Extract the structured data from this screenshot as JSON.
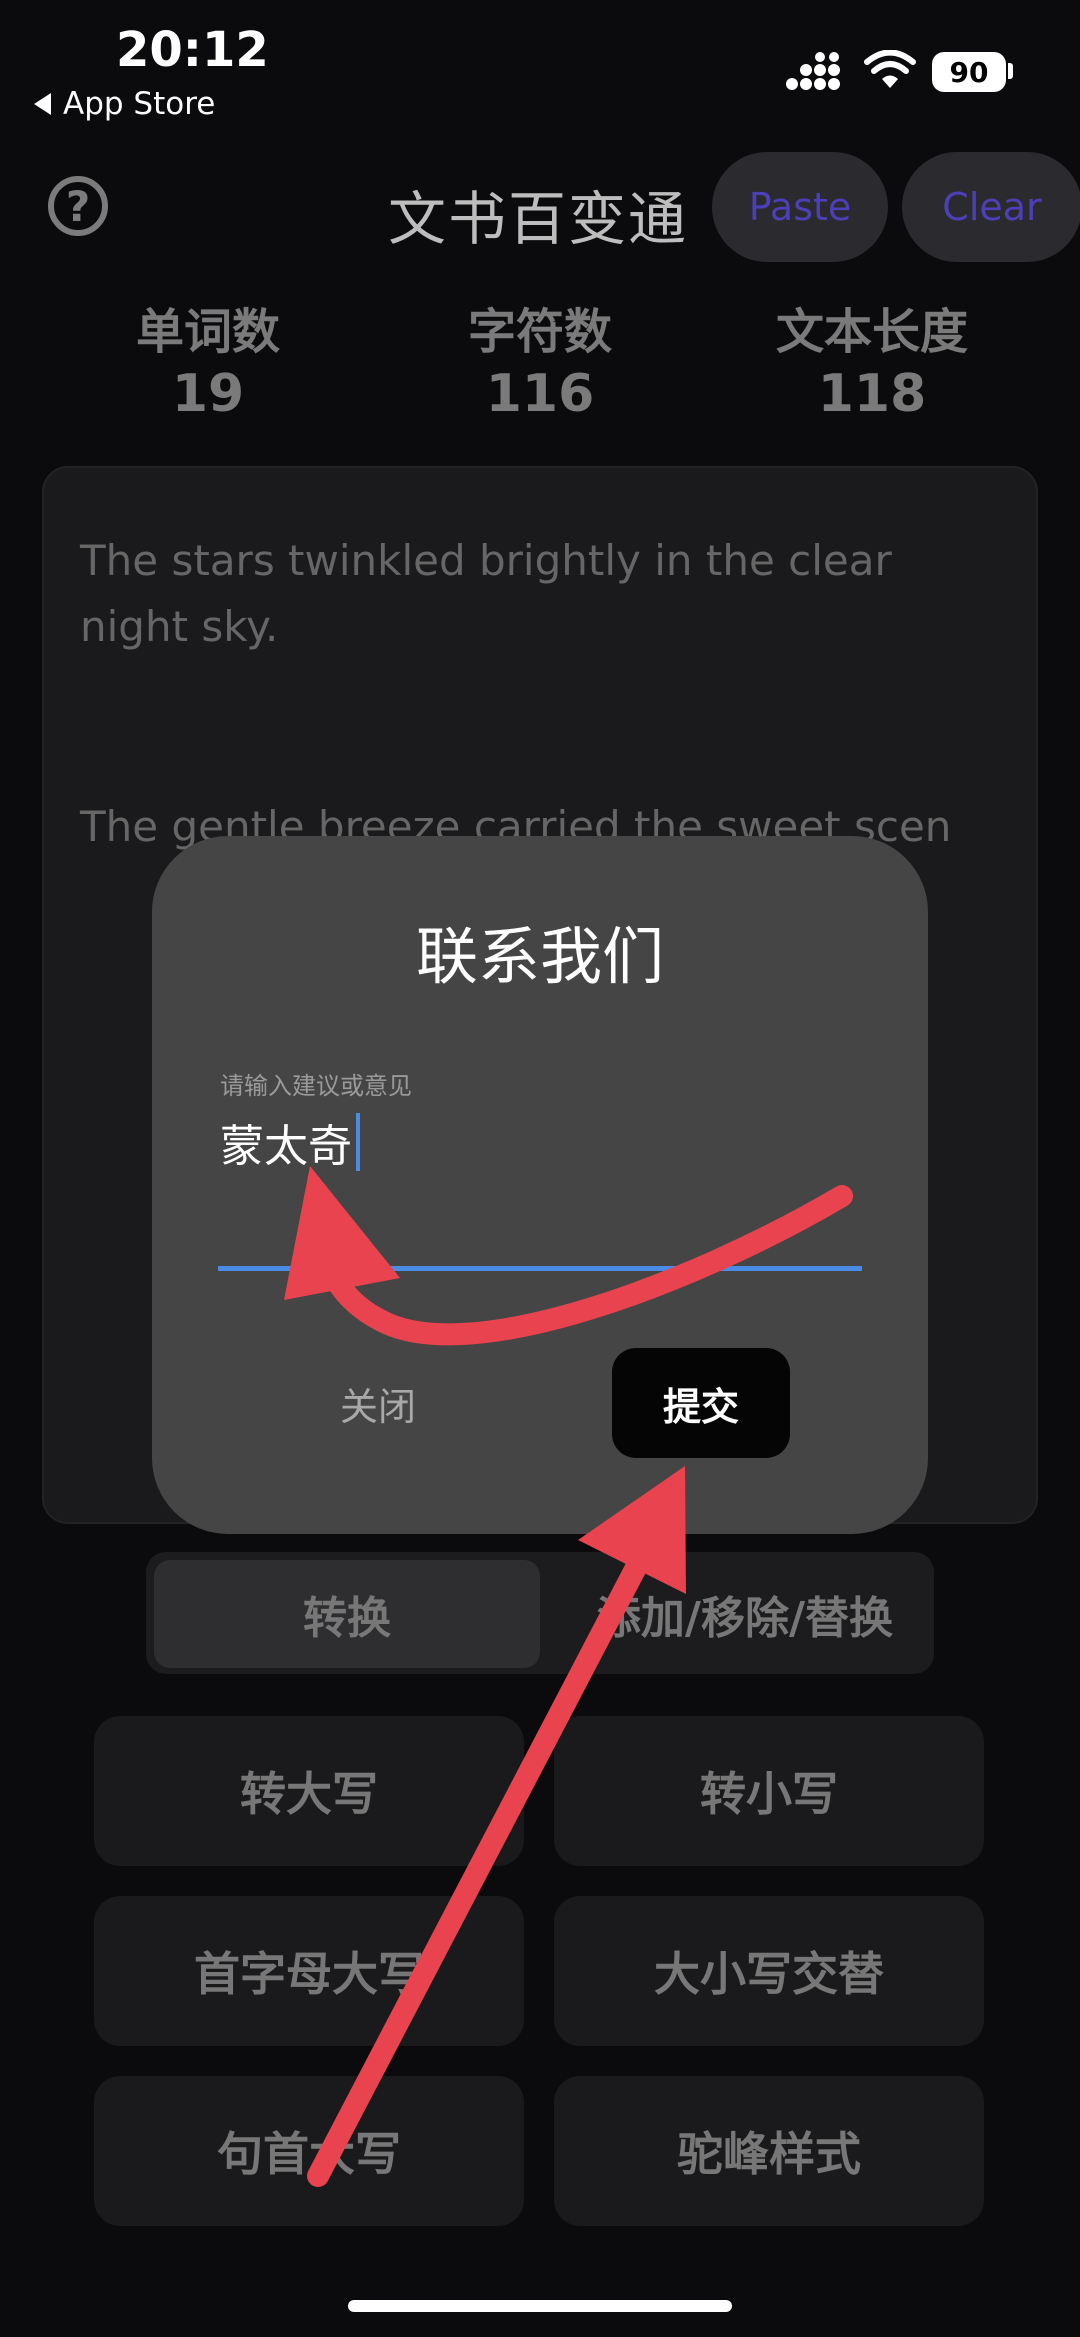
{
  "status_bar": {
    "time": "20:12",
    "back_label": "App Store",
    "battery": "90"
  },
  "header": {
    "title": "文书百变通",
    "paste_label": "Paste",
    "clear_label": "Clear",
    "help_icon": "question-circle-icon"
  },
  "stats": [
    {
      "label": "单词数",
      "value": "19"
    },
    {
      "label": "字符数",
      "value": "116"
    },
    {
      "label": "文本长度",
      "value": "118"
    }
  ],
  "editor": {
    "paragraph1": "The stars  twinkled brightly in  the clear night sky.",
    "paragraph2": "The gentle breeze carried the sweet scen"
  },
  "segmented": {
    "active": "转换",
    "other": "添加/移除/替换"
  },
  "actions": [
    "转大写",
    "转小写",
    "首字母大写",
    "大小写交替",
    "句首大写",
    "驼峰样式"
  ],
  "dialog": {
    "title": "联系我们",
    "input_placeholder": "请输入建议或意见",
    "input_value": "蒙太奇",
    "close_label": "关闭",
    "submit_label": "提交"
  },
  "colors": {
    "accent_blue": "#4a8be6",
    "annotation_red": "#e8434f",
    "paste_text": "#4d3fb8"
  }
}
